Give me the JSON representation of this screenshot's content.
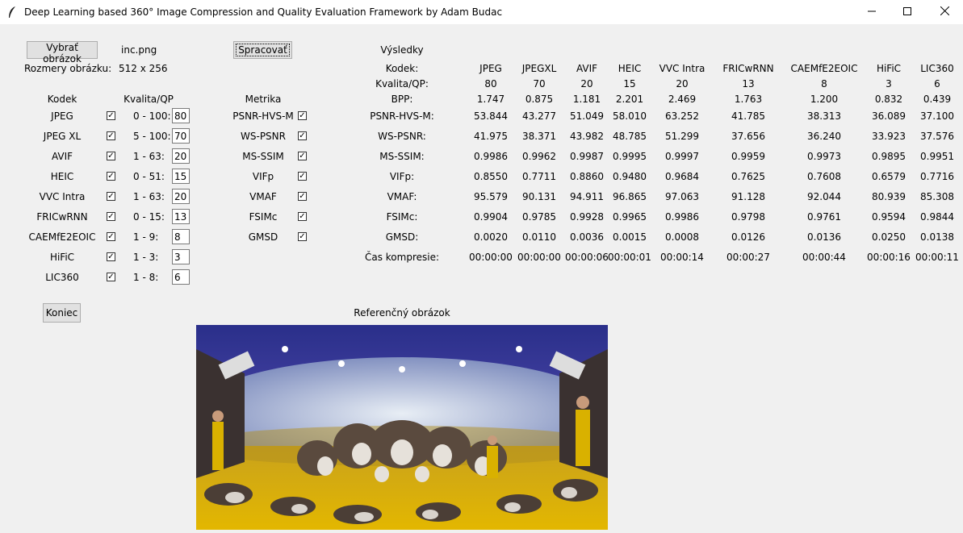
{
  "window": {
    "title": "Deep Learning based 360° Image Compression and Quality Evaluation Framework by Adam Budac",
    "minimize_icon": "minimize-icon",
    "maximize_icon": "maximize-icon",
    "close_icon": "close-icon"
  },
  "controls": {
    "select_image_button": "Vybrať obrázok",
    "filename": "inc.png",
    "size_label": "Rozmery obrázku:",
    "size_value": "512 x 256",
    "process_button": "Spracovať",
    "quit_button": "Koniec"
  },
  "codecs_panel": {
    "codec_header": "Kodek",
    "quality_header": "Kvalita/QP",
    "rows": [
      {
        "name": "JPEG",
        "checked": true,
        "range": "0 - 100:",
        "value": "80"
      },
      {
        "name": "JPEG XL",
        "checked": true,
        "range": "5 - 100:",
        "value": "70"
      },
      {
        "name": "AVIF",
        "checked": true,
        "range": "1 - 63:",
        "value": "20"
      },
      {
        "name": "HEIC",
        "checked": true,
        "range": "0 - 51:",
        "value": "15"
      },
      {
        "name": "VVC Intra",
        "checked": true,
        "range": "1 - 63:",
        "value": "20"
      },
      {
        "name": "FRICwRNN",
        "checked": true,
        "range": "0 - 15:",
        "value": "13"
      },
      {
        "name": "CAEMfE2EOIC",
        "checked": true,
        "range": "1 - 9:",
        "value": "8"
      },
      {
        "name": "HiFiC",
        "checked": true,
        "range": "1 - 3:",
        "value": "3"
      },
      {
        "name": "LIC360",
        "checked": true,
        "range": "1 - 8:",
        "value": "6"
      }
    ]
  },
  "metrics_panel": {
    "header": "Metrika",
    "rows": [
      {
        "name": "PSNR-HVS-M",
        "checked": true
      },
      {
        "name": "WS-PSNR",
        "checked": true
      },
      {
        "name": "MS-SSIM",
        "checked": true
      },
      {
        "name": "VIFp",
        "checked": true
      },
      {
        "name": "VMAF",
        "checked": true
      },
      {
        "name": "FSIMc",
        "checked": true
      },
      {
        "name": "GMSD",
        "checked": true
      }
    ]
  },
  "results": {
    "title": "Výsledky",
    "row_labels": [
      "Kodek:",
      "Kvalita/QP:",
      "BPP:",
      "PSNR-HVS-M:",
      "WS-PSNR:",
      "MS-SSIM:",
      "VIFp:",
      "VMAF:",
      "FSIMc:",
      "GMSD:",
      "Čas kompresie:"
    ],
    "columns": [
      {
        "codec": "JPEG",
        "values": [
          "80",
          "1.747",
          "53.844",
          "41.975",
          "0.9986",
          "0.8550",
          "95.579",
          "0.9904",
          "0.0020",
          "00:00:00"
        ]
      },
      {
        "codec": "JPEGXL",
        "values": [
          "70",
          "0.875",
          "43.277",
          "38.371",
          "0.9962",
          "0.7711",
          "90.131",
          "0.9785",
          "0.0110",
          "00:00:00"
        ]
      },
      {
        "codec": "AVIF",
        "values": [
          "20",
          "1.181",
          "51.049",
          "43.982",
          "0.9987",
          "0.8860",
          "94.911",
          "0.9928",
          "0.0036",
          "00:00:06"
        ]
      },
      {
        "codec": "HEIC",
        "values": [
          "15",
          "2.201",
          "58.010",
          "48.785",
          "0.9995",
          "0.9480",
          "96.865",
          "0.9965",
          "0.0015",
          "00:00:01"
        ]
      },
      {
        "codec": "VVC Intra",
        "values": [
          "20",
          "2.469",
          "63.252",
          "51.299",
          "0.9997",
          "0.9684",
          "97.063",
          "0.9986",
          "0.0008",
          "00:00:14"
        ]
      },
      {
        "codec": "FRICwRNN",
        "values": [
          "13",
          "1.763",
          "41.785",
          "37.656",
          "0.9959",
          "0.7625",
          "91.128",
          "0.9798",
          "0.0126",
          "00:00:27"
        ]
      },
      {
        "codec": "CAEMfE2EOIC",
        "values": [
          "8",
          "1.200",
          "38.313",
          "36.240",
          "0.9973",
          "0.7608",
          "92.044",
          "0.9761",
          "0.0136",
          "00:00:44"
        ]
      },
      {
        "codec": "HiFiC",
        "values": [
          "3",
          "0.832",
          "36.089",
          "33.923",
          "0.9895",
          "0.6579",
          "80.939",
          "0.9594",
          "0.0250",
          "00:00:16"
        ]
      },
      {
        "codec": "LIC360",
        "values": [
          "6",
          "0.439",
          "37.100",
          "37.576",
          "0.9951",
          "0.7716",
          "85.308",
          "0.9844",
          "0.0138",
          "00:00:11"
        ]
      }
    ]
  },
  "reference": {
    "label": "Referenčný obrázok"
  }
}
